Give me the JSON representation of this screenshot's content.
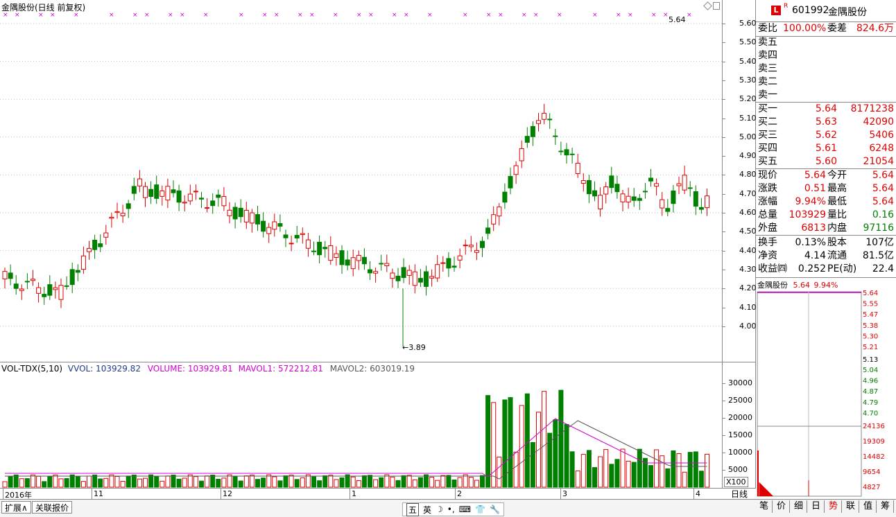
{
  "main": {
    "title": "金隅股份(日线 前复权)",
    "high_label": "←3.89",
    "current_label": "5.64",
    "price_ticks": [
      "5.60",
      "5.50",
      "5.40",
      "5.30",
      "5.20",
      "5.10",
      "5.00",
      "4.90",
      "4.80",
      "4.70",
      "4.60",
      "4.50",
      "4.40",
      "4.30",
      "4.20",
      "4.10",
      "4.00"
    ]
  },
  "indicator": {
    "name": "VOL-TDX(5,10)",
    "vvol": "VVOL: 103929.82",
    "volume": "VOLUME: 103929.81",
    "mavol1": "MAVOL1: 572212.81",
    "mavol2": "MAVOL2: 603019.19",
    "vol_ticks": [
      "30000",
      "25000",
      "20000",
      "15000",
      "10000",
      "5000"
    ],
    "unit": "X100"
  },
  "dates": [
    "2016年",
    "11",
    "12",
    "1",
    "2",
    "3",
    "4"
  ],
  "period": "日线",
  "bottom": {
    "expand_label": "扩展∧",
    "related_label": "关联报价",
    "ime_items": [
      "五",
      "英",
      "☽",
      "•,",
      "⌨",
      "👕",
      "🔧"
    ]
  },
  "quote": {
    "code": "601992",
    "name": "金隅股份",
    "weibi_label": "委比",
    "weibi": "100.00%",
    "weicha_label": "委差",
    "weicha": "824.6万",
    "sells": [
      {
        "label": "卖五",
        "price": "",
        "vol": ""
      },
      {
        "label": "卖四",
        "price": "",
        "vol": ""
      },
      {
        "label": "卖三",
        "price": "",
        "vol": ""
      },
      {
        "label": "卖二",
        "price": "",
        "vol": ""
      },
      {
        "label": "卖一",
        "price": "",
        "vol": ""
      }
    ],
    "buys": [
      {
        "label": "买一",
        "price": "5.64",
        "vol": "8171238"
      },
      {
        "label": "买二",
        "price": "5.63",
        "vol": "42090"
      },
      {
        "label": "买三",
        "price": "5.62",
        "vol": "5406"
      },
      {
        "label": "买四",
        "price": "5.61",
        "vol": "6248"
      },
      {
        "label": "买五",
        "price": "5.60",
        "vol": "21054"
      }
    ],
    "stats": [
      {
        "l1": "现价",
        "v1": "5.64",
        "l2": "今开",
        "v2": "5.64",
        "c1": "red",
        "c2": "red"
      },
      {
        "l1": "涨跌",
        "v1": "0.51",
        "l2": "最高",
        "v2": "5.64",
        "c1": "red",
        "c2": "red"
      },
      {
        "l1": "涨幅",
        "v1": "9.94%",
        "l2": "最低",
        "v2": "5.64",
        "c1": "red",
        "c2": "red"
      },
      {
        "l1": "总量",
        "v1": "103929",
        "l2": "量比",
        "v2": "0.16",
        "c1": "red",
        "c2": "green"
      },
      {
        "l1": "外盘",
        "v1": "6813",
        "l2": "内盘",
        "v2": "97116",
        "c1": "red",
        "c2": "green"
      }
    ],
    "stats2": [
      {
        "l1": "换手",
        "v1": "0.13%",
        "l2": "股本",
        "v2": "107亿"
      },
      {
        "l1": "净资",
        "v1": "4.14",
        "l2": "流通",
        "v2": "81.5亿"
      },
      {
        "l1": "收益㈣",
        "v1": "0.252",
        "l2": "PE(动)",
        "v2": "22.4"
      }
    ],
    "mini_title": "金隅股份",
    "mini_price": "5.64",
    "mini_pct": "9.94%",
    "mini_ticks_red": [
      "5.64",
      "5.55",
      "5.47",
      "5.38",
      "5.30",
      "5.21"
    ],
    "mini_tick_mid": "5.13",
    "mini_ticks_green": [
      "5.04",
      "4.96",
      "4.87",
      "4.79",
      "4.70"
    ],
    "mini_vol_ticks": [
      "24136",
      "19309",
      "14482",
      "9654",
      "4827"
    ],
    "tabs": [
      "笔",
      "价",
      "细",
      "日",
      "势",
      "联",
      "值",
      "筹"
    ]
  }
}
